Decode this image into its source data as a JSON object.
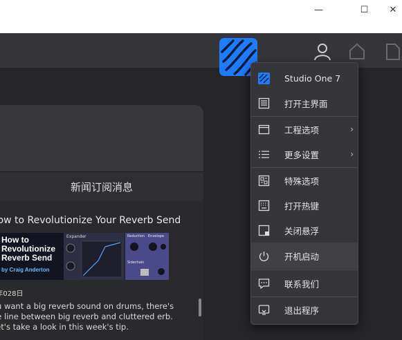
{
  "window": {
    "minimize_glyph": "—",
    "maximize_glyph": "☐",
    "close_glyph": "✕"
  },
  "toolbar": {
    "icons": [
      "app-logo-icon",
      "user-icon",
      "home-icon",
      "document-icon"
    ],
    "accent_color": "#1e7cff"
  },
  "news": {
    "header": "新闻订阅消息",
    "article_title": "How to Revolutionize Your Reverb Send",
    "image": {
      "headline_line1": "How to",
      "headline_line2": "Revolutionize",
      "headline_line3": "Reverb Send",
      "author": "by Craig Anderton",
      "plugin_name": "Expander",
      "panel_label_1": "Reduction",
      "panel_label_2": "Envelope",
      "panel_label_3": "Sidechain"
    },
    "date": "5年028日",
    "body": "ou want a big reverb sound on drums, there's ne line between big reverb and cluttered erb. Let's take a look in this week's tip."
  },
  "menu": {
    "items": [
      {
        "label": "Studio One 7",
        "icon": "studio-one-logo-icon"
      },
      {
        "label": "打开主界面",
        "icon": "main-window-icon"
      },
      {
        "label": "工程选项",
        "icon": "window-icon",
        "submenu": true
      },
      {
        "label": "更多设置",
        "icon": "list-icon",
        "submenu": true
      },
      {
        "label": "特殊选项",
        "icon": "special-options-icon"
      },
      {
        "label": "打开热键",
        "icon": "keyboard-icon"
      },
      {
        "label": "关闭悬浮",
        "icon": "float-close-icon"
      },
      {
        "label": "开机启动",
        "icon": "power-icon"
      },
      {
        "label": "联系我们",
        "icon": "chat-icon"
      },
      {
        "label": "退出程序",
        "icon": "exit-icon"
      }
    ],
    "submenu_arrow": "›"
  }
}
